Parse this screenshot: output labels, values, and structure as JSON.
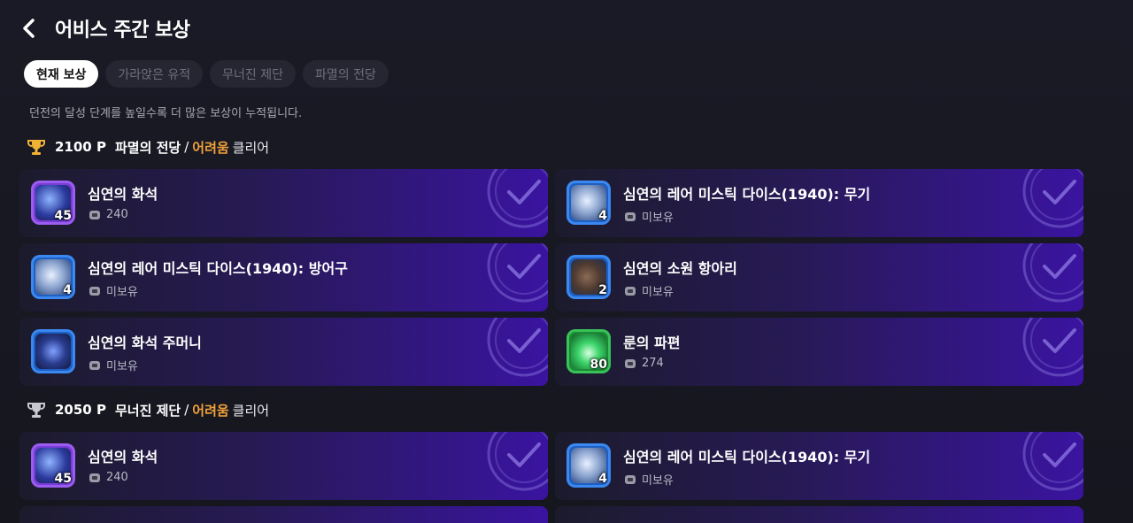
{
  "header": {
    "title": "어비스 주간 보상"
  },
  "tabs": [
    {
      "label": "현재 보상",
      "active": true
    },
    {
      "label": "가라앉은 유적",
      "active": false
    },
    {
      "label": "무너진 제단",
      "active": false
    },
    {
      "label": "파멸의 전당",
      "active": false
    }
  ],
  "description": "던전의 달성 단계를 높일수록 더 많은 보상이 누적됩니다.",
  "sections": [
    {
      "points": "2100 P",
      "dungeon": "파멸의 전당",
      "separator": "/",
      "difficulty": "어려움",
      "clear": "클리어",
      "rewards": [
        {
          "name": "심연의 화석",
          "qty": "45",
          "owned": "240",
          "frame": "purple"
        },
        {
          "name": "심연의 레어 미스틱 다이스(1940): 무기",
          "qty": "4",
          "owned": "미보유",
          "frame": "blue"
        },
        {
          "name": "심연의 레어 미스틱 다이스(1940): 방어구",
          "qty": "4",
          "owned": "미보유",
          "frame": "blue"
        },
        {
          "name": "심연의 소원 항아리",
          "qty": "2",
          "owned": "미보유",
          "frame": "blue"
        },
        {
          "name": "심연의 화석 주머니",
          "qty": "",
          "owned": "미보유",
          "frame": "blue"
        },
        {
          "name": "룬의 파편",
          "qty": "80",
          "owned": "274",
          "frame": "green"
        }
      ]
    },
    {
      "points": "2050 P",
      "dungeon": "무너진 제단",
      "separator": "/",
      "difficulty": "어려움",
      "clear": "클리어",
      "rewards": [
        {
          "name": "심연의 화석",
          "qty": "45",
          "owned": "240",
          "frame": "purple"
        },
        {
          "name": "심연의 레어 미스틱 다이스(1940): 무기",
          "qty": "4",
          "owned": "미보유",
          "frame": "blue"
        }
      ]
    }
  ],
  "colors": {
    "accent": "#f2a23a",
    "card_end": "#3a14a0",
    "background": "#16161f"
  },
  "icons": {
    "back": "chevron-left-icon",
    "trophy_gold": "trophy-gold-icon",
    "trophy_silver": "trophy-silver-icon",
    "check": "check-circle-icon",
    "coin": "owned-count-icon"
  }
}
